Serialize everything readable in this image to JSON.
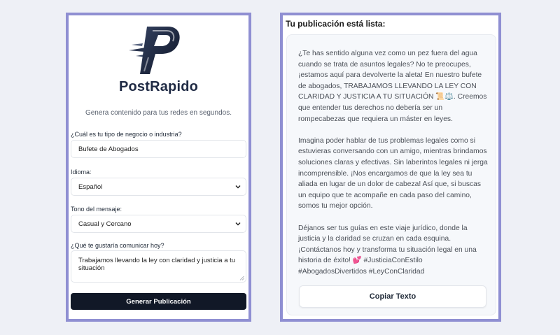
{
  "generator": {
    "brand": "PostRapido",
    "tagline": "Genera contenido para tus redes en segundos.",
    "business": {
      "label": "¿Cuál es tu tipo de negocio o industria?",
      "value": "Bufete de Abogados"
    },
    "language": {
      "label": "Idioma:",
      "value": "Español"
    },
    "tone": {
      "label": "Tono del mensaje:",
      "value": "Casual y Cercano"
    },
    "message": {
      "label": "¿Qué te gustaría comunicar hoy?",
      "value": "Trabajamos llevando la ley con claridad y justicia a tu situación"
    },
    "submit_label": "Generar Publicación"
  },
  "result": {
    "title": "Tu publicación está lista:",
    "paragraphs": [
      "¿Te has sentido alguna vez como un pez fuera del agua cuando se trata de asuntos legales? No te preocupes, ¡estamos aquí para devolverte la aleta! En nuestro bufete de abogados, TRABAJAMOS LLEVANDO LA LEY CON CLARIDAD Y JUSTICIA A TU SITUACIÓN 📜⚖️. Creemos que entender tus derechos no debería ser un rompecabezas que requiera un máster en leyes.",
      "Imagina poder hablar de tus problemas legales como si estuvieras conversando con un amigo, mientras brindamos soluciones claras y efectivas. Sin laberintos legales ni jerga incomprensible. ¡Nos encargamos de que la ley sea tu aliada en lugar de un dolor de cabeza! Así que, si buscas un equipo que te acompañe en cada paso del camino, somos tu mejor opción.",
      "Déjanos ser tus guías en este viaje jurídico, donde la justicia y la claridad se cruzan en cada esquina. ¡Contáctanos hoy y transforma tu situación legal en una historia de éxito! 💕 #JusticiaConEstilo #AbogadosDivertidos #LeyConClaridad"
    ],
    "copy_label": "Copiar Texto"
  },
  "colors": {
    "page_background": "#eef0f6",
    "panel_border": "#8f8fd2",
    "primary_button": "#111827",
    "brand_text": "#1f2a44"
  },
  "icons": {
    "logo": "postrapido-logo-icon",
    "select_arrow": "chevron-down-icon",
    "resize_handle": "resize-grip-icon"
  }
}
